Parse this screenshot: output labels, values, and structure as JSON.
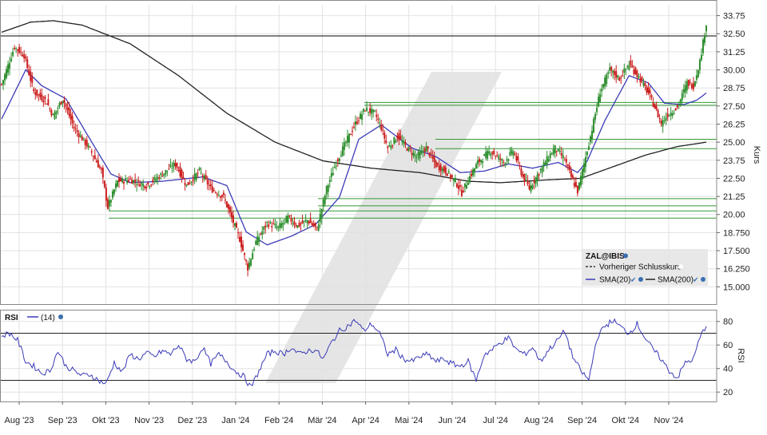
{
  "chart_data": {
    "type": "candlestick",
    "title": "",
    "ylabel": "Kurs",
    "ylim": [
      13.75,
      34.5
    ],
    "yticks": [
      "33.75",
      "32.50",
      "31.25",
      "30.00",
      "28.75",
      "27.50",
      "26.25",
      "25.00",
      "23.75",
      "22.50",
      "21.25",
      "20.00",
      "18.750",
      "17.500",
      "16.250",
      "15.000"
    ],
    "x_months": [
      "Aug '23",
      "Sep '23",
      "Okt '23",
      "Nov '23",
      "Dez '23",
      "Jan '24",
      "Feb '24",
      "Mär '24",
      "Apr '24",
      "Mai '24",
      "Jun '24",
      "Jul '24",
      "Aug '24",
      "Sep '24",
      "Okt '24",
      "Nov '24"
    ],
    "price_anchors": [
      [
        0,
        29.0
      ],
      [
        8,
        31.6
      ],
      [
        14,
        31.0
      ],
      [
        20,
        28.5
      ],
      [
        28,
        27.8
      ],
      [
        32,
        26.8
      ],
      [
        38,
        28.0
      ],
      [
        45,
        26.0
      ],
      [
        55,
        24.5
      ],
      [
        62,
        23.0
      ],
      [
        66,
        20.5
      ],
      [
        72,
        22.3
      ],
      [
        80,
        22.4
      ],
      [
        90,
        22.0
      ],
      [
        100,
        22.8
      ],
      [
        108,
        23.5
      ],
      [
        115,
        22.0
      ],
      [
        123,
        23.0
      ],
      [
        130,
        21.8
      ],
      [
        138,
        21.2
      ],
      [
        148,
        18.3
      ],
      [
        153,
        16.3
      ],
      [
        158,
        18.1
      ],
      [
        165,
        19.4
      ],
      [
        172,
        19.1
      ],
      [
        178,
        19.8
      ],
      [
        184,
        19.2
      ],
      [
        190,
        19.6
      ],
      [
        196,
        19.0
      ],
      [
        202,
        21.8
      ],
      [
        208,
        23.6
      ],
      [
        214,
        25.0
      ],
      [
        220,
        26.3
      ],
      [
        226,
        27.3
      ],
      [
        232,
        27.0
      ],
      [
        236,
        26.0
      ],
      [
        240,
        24.6
      ],
      [
        246,
        25.4
      ],
      [
        252,
        24.6
      ],
      [
        258,
        24.0
      ],
      [
        264,
        24.6
      ],
      [
        270,
        23.4
      ],
      [
        276,
        23.0
      ],
      [
        282,
        22.3
      ],
      [
        286,
        21.5
      ],
      [
        290,
        22.4
      ],
      [
        296,
        23.6
      ],
      [
        304,
        24.4
      ],
      [
        312,
        23.6
      ],
      [
        318,
        24.4
      ],
      [
        324,
        22.6
      ],
      [
        328,
        21.8
      ],
      [
        334,
        22.9
      ],
      [
        340,
        24.0
      ],
      [
        344,
        24.6
      ],
      [
        350,
        23.8
      ],
      [
        354,
        22.6
      ],
      [
        358,
        21.6
      ],
      [
        362,
        23.5
      ],
      [
        366,
        25.4
      ],
      [
        372,
        28.5
      ],
      [
        378,
        30.0
      ],
      [
        384,
        29.4
      ],
      [
        390,
        30.4
      ],
      [
        396,
        29.5
      ],
      [
        402,
        28.4
      ],
      [
        406,
        27.4
      ],
      [
        410,
        26.3
      ],
      [
        414,
        26.9
      ],
      [
        420,
        27.4
      ],
      [
        426,
        29.1
      ],
      [
        430,
        28.9
      ],
      [
        434,
        30.6
      ],
      [
        438,
        33.2
      ]
    ],
    "sma20_anchors": [
      [
        0,
        26.6
      ],
      [
        15,
        30.0
      ],
      [
        25,
        28.9
      ],
      [
        40,
        28.0
      ],
      [
        55,
        25.2
      ],
      [
        68,
        22.8
      ],
      [
        80,
        22.2
      ],
      [
        100,
        22.3
      ],
      [
        125,
        22.6
      ],
      [
        140,
        22.0
      ],
      [
        152,
        18.8
      ],
      [
        165,
        17.9
      ],
      [
        180,
        18.5
      ],
      [
        195,
        19.3
      ],
      [
        210,
        21.2
      ],
      [
        222,
        25.2
      ],
      [
        236,
        26.2
      ],
      [
        255,
        24.6
      ],
      [
        270,
        24.0
      ],
      [
        285,
        22.9
      ],
      [
        300,
        23.0
      ],
      [
        315,
        23.5
      ],
      [
        330,
        23.2
      ],
      [
        346,
        23.6
      ],
      [
        358,
        22.9
      ],
      [
        364,
        23.7
      ],
      [
        375,
        26.5
      ],
      [
        390,
        29.6
      ],
      [
        402,
        29.1
      ],
      [
        412,
        27.7
      ],
      [
        424,
        27.6
      ],
      [
        432,
        27.9
      ],
      [
        438,
        28.4
      ]
    ],
    "sma200_anchors": [
      [
        0,
        32.6
      ],
      [
        18,
        33.3
      ],
      [
        32,
        33.4
      ],
      [
        50,
        33.1
      ],
      [
        80,
        31.8
      ],
      [
        110,
        29.6
      ],
      [
        140,
        27.0
      ],
      [
        170,
        25.0
      ],
      [
        200,
        23.7
      ],
      [
        230,
        23.2
      ],
      [
        260,
        22.9
      ],
      [
        290,
        22.3
      ],
      [
        310,
        22.2
      ],
      [
        340,
        22.4
      ],
      [
        360,
        22.5
      ],
      [
        380,
        23.3
      ],
      [
        400,
        24.1
      ],
      [
        420,
        24.7
      ],
      [
        438,
        25.0
      ]
    ],
    "rsi_anchors": [
      [
        0,
        68
      ],
      [
        5,
        70
      ],
      [
        10,
        64
      ],
      [
        15,
        46
      ],
      [
        20,
        42
      ],
      [
        25,
        36
      ],
      [
        30,
        38
      ],
      [
        35,
        55
      ],
      [
        40,
        42
      ],
      [
        45,
        38
      ],
      [
        50,
        34
      ],
      [
        55,
        35
      ],
      [
        60,
        30
      ],
      [
        65,
        27
      ],
      [
        70,
        45
      ],
      [
        75,
        37
      ],
      [
        80,
        52
      ],
      [
        85,
        48
      ],
      [
        90,
        53
      ],
      [
        95,
        50
      ],
      [
        100,
        55
      ],
      [
        105,
        52
      ],
      [
        110,
        60
      ],
      [
        115,
        48
      ],
      [
        120,
        46
      ],
      [
        125,
        58
      ],
      [
        130,
        44
      ],
      [
        135,
        52
      ],
      [
        140,
        46
      ],
      [
        145,
        38
      ],
      [
        150,
        34
      ],
      [
        155,
        24
      ],
      [
        160,
        38
      ],
      [
        165,
        52
      ],
      [
        170,
        55
      ],
      [
        175,
        52
      ],
      [
        180,
        58
      ],
      [
        185,
        52
      ],
      [
        190,
        55
      ],
      [
        195,
        56
      ],
      [
        200,
        48
      ],
      [
        205,
        62
      ],
      [
        210,
        72
      ],
      [
        215,
        76
      ],
      [
        220,
        81
      ],
      [
        225,
        72
      ],
      [
        230,
        78
      ],
      [
        235,
        70
      ],
      [
        240,
        52
      ],
      [
        245,
        56
      ],
      [
        250,
        48
      ],
      [
        255,
        46
      ],
      [
        260,
        50
      ],
      [
        265,
        52
      ],
      [
        270,
        46
      ],
      [
        275,
        48
      ],
      [
        280,
        44
      ],
      [
        285,
        42
      ],
      [
        290,
        46
      ],
      [
        295,
        30
      ],
      [
        300,
        52
      ],
      [
        305,
        56
      ],
      [
        310,
        62
      ],
      [
        315,
        66
      ],
      [
        320,
        56
      ],
      [
        325,
        52
      ],
      [
        330,
        58
      ],
      [
        335,
        46
      ],
      [
        340,
        56
      ],
      [
        345,
        63
      ],
      [
        350,
        72
      ],
      [
        355,
        50
      ],
      [
        360,
        38
      ],
      [
        365,
        30
      ],
      [
        370,
        66
      ],
      [
        375,
        76
      ],
      [
        380,
        81
      ],
      [
        385,
        75
      ],
      [
        390,
        70
      ],
      [
        395,
        78
      ],
      [
        400,
        66
      ],
      [
        405,
        56
      ],
      [
        410,
        48
      ],
      [
        415,
        38
      ],
      [
        420,
        32
      ],
      [
        425,
        45
      ],
      [
        430,
        48
      ],
      [
        434,
        66
      ],
      [
        438,
        77
      ]
    ],
    "horizontal_lines": [
      {
        "value": 32.35,
        "color": "#000000"
      },
      {
        "value": 27.75,
        "color": "#339933"
      },
      {
        "value": 27.55,
        "color": "#339933"
      },
      {
        "value": 25.2,
        "color": "#339933"
      },
      {
        "value": 24.55,
        "color": "#339933"
      },
      {
        "value": 21.1,
        "color": "#339933"
      },
      {
        "value": 20.6,
        "color": "#339933"
      },
      {
        "value": 20.25,
        "color": "#339933"
      },
      {
        "value": 19.75,
        "color": "#339933"
      }
    ],
    "legend": {
      "symbol": "ZAL@IBIS",
      "prev_close": "Vorheriger Schlusskurs",
      "sma20": "SMA(20)",
      "sma200": "SMA(200)",
      "placement": "bottom-right"
    },
    "rsi": {
      "label": "RSI",
      "period": "(14)",
      "ylabel": "RSI",
      "ylim": [
        12,
        90
      ],
      "yticks": [
        "80",
        "60",
        "40",
        "20"
      ],
      "bands": [
        70,
        30
      ]
    },
    "colors": {
      "up": "#2f8f2f",
      "down": "#cc1f1f",
      "sma20": "#3a3ab8",
      "sma200": "#222222",
      "support": "#339933",
      "rsi": "#3a3ab8",
      "watermark": "#dcdcdc"
    }
  }
}
